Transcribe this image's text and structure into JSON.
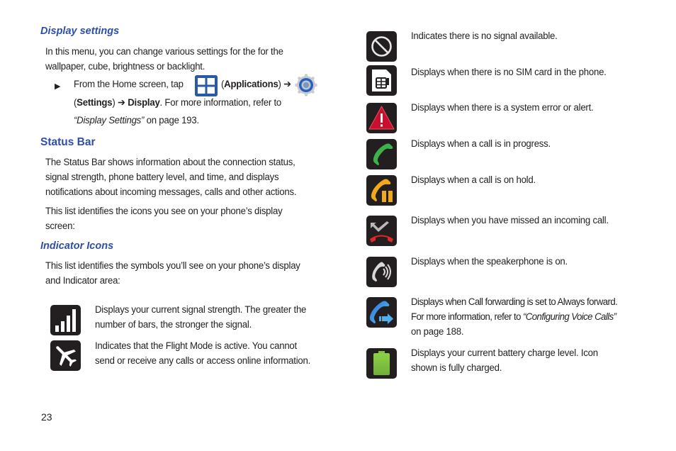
{
  "page_number": "23",
  "display_settings": {
    "heading": "Display settings",
    "intro_line1": "In this menu, you can change various settings for the for the",
    "intro_line2": "wallpaper, cube, brightness or backlight.",
    "step": {
      "bullet": "▶",
      "part1": "From the Home screen, tap",
      "apps_icon": "applications-grid-icon",
      "apps_open": "(",
      "apps_label": "Applications",
      "apps_close": ")",
      "arrow1": "➔",
      "settings_icon": "settings-gear-icon",
      "settings_open": "(",
      "settings_label": "Settings",
      "settings_close": ")",
      "arrow2": "➔",
      "display_label": "Display",
      "part2": ". For more information, refer to",
      "ref_link": "“Display Settings”",
      "ref_page": " on page 193."
    }
  },
  "status_bar": {
    "heading": "Status Bar",
    "para1": [
      "The Status Bar shows information about the connection status,",
      "signal strength, phone battery level, and time, and displays",
      "notifications about incoming messages, calls and other actions."
    ],
    "para2": [
      "This list identifies the icons you see on your phone’s display",
      "screen:"
    ]
  },
  "indicator_icons": {
    "heading": "Indicator Icons",
    "intro": [
      "This list identifies the symbols you’ll see on your phone’s display",
      "and Indicator area:"
    ],
    "left_items": [
      {
        "icon": "signal-strength-icon",
        "lines": [
          "Displays your current signal strength. The greater the",
          "number of bars, the stronger the signal."
        ]
      },
      {
        "icon": "flight-mode-icon",
        "lines": [
          "Indicates that the Flight Mode is active. You cannot",
          "send or receive any calls or access online information."
        ]
      }
    ],
    "right_items": [
      {
        "icon": "no-signal-icon",
        "lines": [
          "Indicates there is no signal available."
        ]
      },
      {
        "icon": "no-sim-card-icon",
        "lines": [
          "Displays when there is no SIM card in the phone."
        ]
      },
      {
        "icon": "system-alert-icon",
        "lines": [
          "Displays when there is a system error or alert."
        ]
      },
      {
        "icon": "call-in-progress-icon",
        "lines": [
          "Displays when a call is in progress."
        ]
      },
      {
        "icon": "call-on-hold-icon",
        "lines": [
          "Displays when a call is on hold."
        ]
      },
      {
        "icon": "missed-call-icon",
        "lines": [
          "Displays when you have missed an incoming call."
        ]
      },
      {
        "icon": "speakerphone-icon",
        "lines": [
          "Displays when the speakerphone is on."
        ]
      },
      {
        "icon": "call-forwarding-icon",
        "lines": [
          "Displays when Call forwarding is set to Always forward.",
          "For more information, refer to ",
          "on page 188."
        ],
        "ref_link": "“Configuring Voice Calls”"
      },
      {
        "icon": "battery-full-icon",
        "lines": [
          "Displays your current battery charge level. Icon",
          "shown is fully charged."
        ]
      }
    ]
  },
  "colors": {
    "heading_blue": "#2e4fa8",
    "icon_bg": "#231f20",
    "alert_red": "#c8102e",
    "call_green": "#3cb34a",
    "hold_orange": "#f0a81c",
    "missed_red": "#e3262b",
    "forward_blue": "#2a8fd6",
    "battery_green": "#7fc242"
  }
}
